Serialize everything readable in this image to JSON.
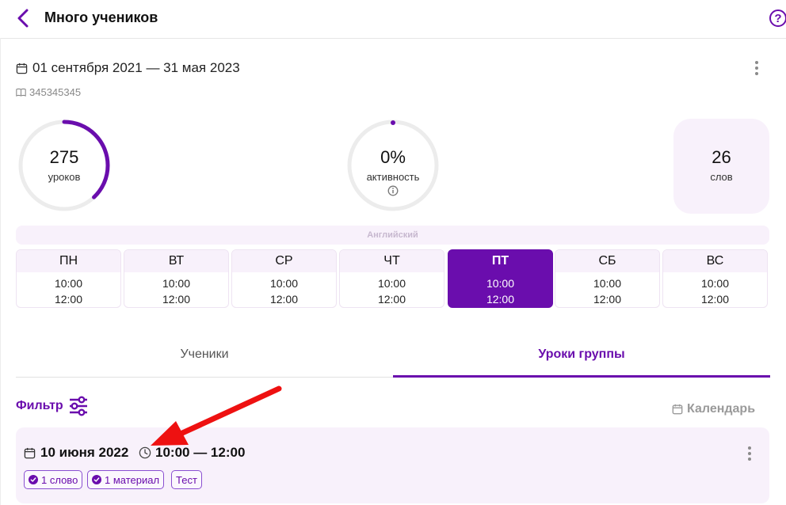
{
  "header": {
    "title": "Много учеников",
    "back_icon": "chevron-left-icon",
    "help_icon": "question-circle-icon",
    "help_glyph": "?"
  },
  "group": {
    "date_range": "01 сентября 2021 — 31 мая 2023",
    "code": "345345345"
  },
  "stats": {
    "lessons": {
      "value": "275",
      "label": "уроков",
      "progress_fraction": 0.38
    },
    "activity": {
      "value": "0%",
      "label": "активность",
      "progress_fraction": 0.0
    },
    "words": {
      "value": "26",
      "label": "слов"
    }
  },
  "schedule": {
    "language": "Английский",
    "days": [
      {
        "name": "ПН",
        "start": "10:00",
        "end": "12:00",
        "active": false
      },
      {
        "name": "ВТ",
        "start": "10:00",
        "end": "12:00",
        "active": false
      },
      {
        "name": "СР",
        "start": "10:00",
        "end": "12:00",
        "active": false
      },
      {
        "name": "ЧТ",
        "start": "10:00",
        "end": "12:00",
        "active": false
      },
      {
        "name": "ПТ",
        "start": "10:00",
        "end": "12:00",
        "active": true
      },
      {
        "name": "СБ",
        "start": "10:00",
        "end": "12:00",
        "active": false
      },
      {
        "name": "ВС",
        "start": "10:00",
        "end": "12:00",
        "active": false
      }
    ]
  },
  "tabs": [
    {
      "label": "Ученики",
      "active": false
    },
    {
      "label": "Уроки группы",
      "active": true
    }
  ],
  "toolbar": {
    "filter_label": "Фильтр",
    "calendar_label": "Календарь"
  },
  "lesson": {
    "date": "10 июня 2022",
    "time": "10:00 — 12:00",
    "badges": [
      {
        "label": "1 слово",
        "checked": true
      },
      {
        "label": "1 материал",
        "checked": true
      },
      {
        "label": "Тест",
        "checked": false
      }
    ]
  },
  "colors": {
    "accent": "#6a0dad",
    "accent_light": "#f8f1fb",
    "arrow": "#ee1111",
    "muted": "#9a9a9a"
  }
}
